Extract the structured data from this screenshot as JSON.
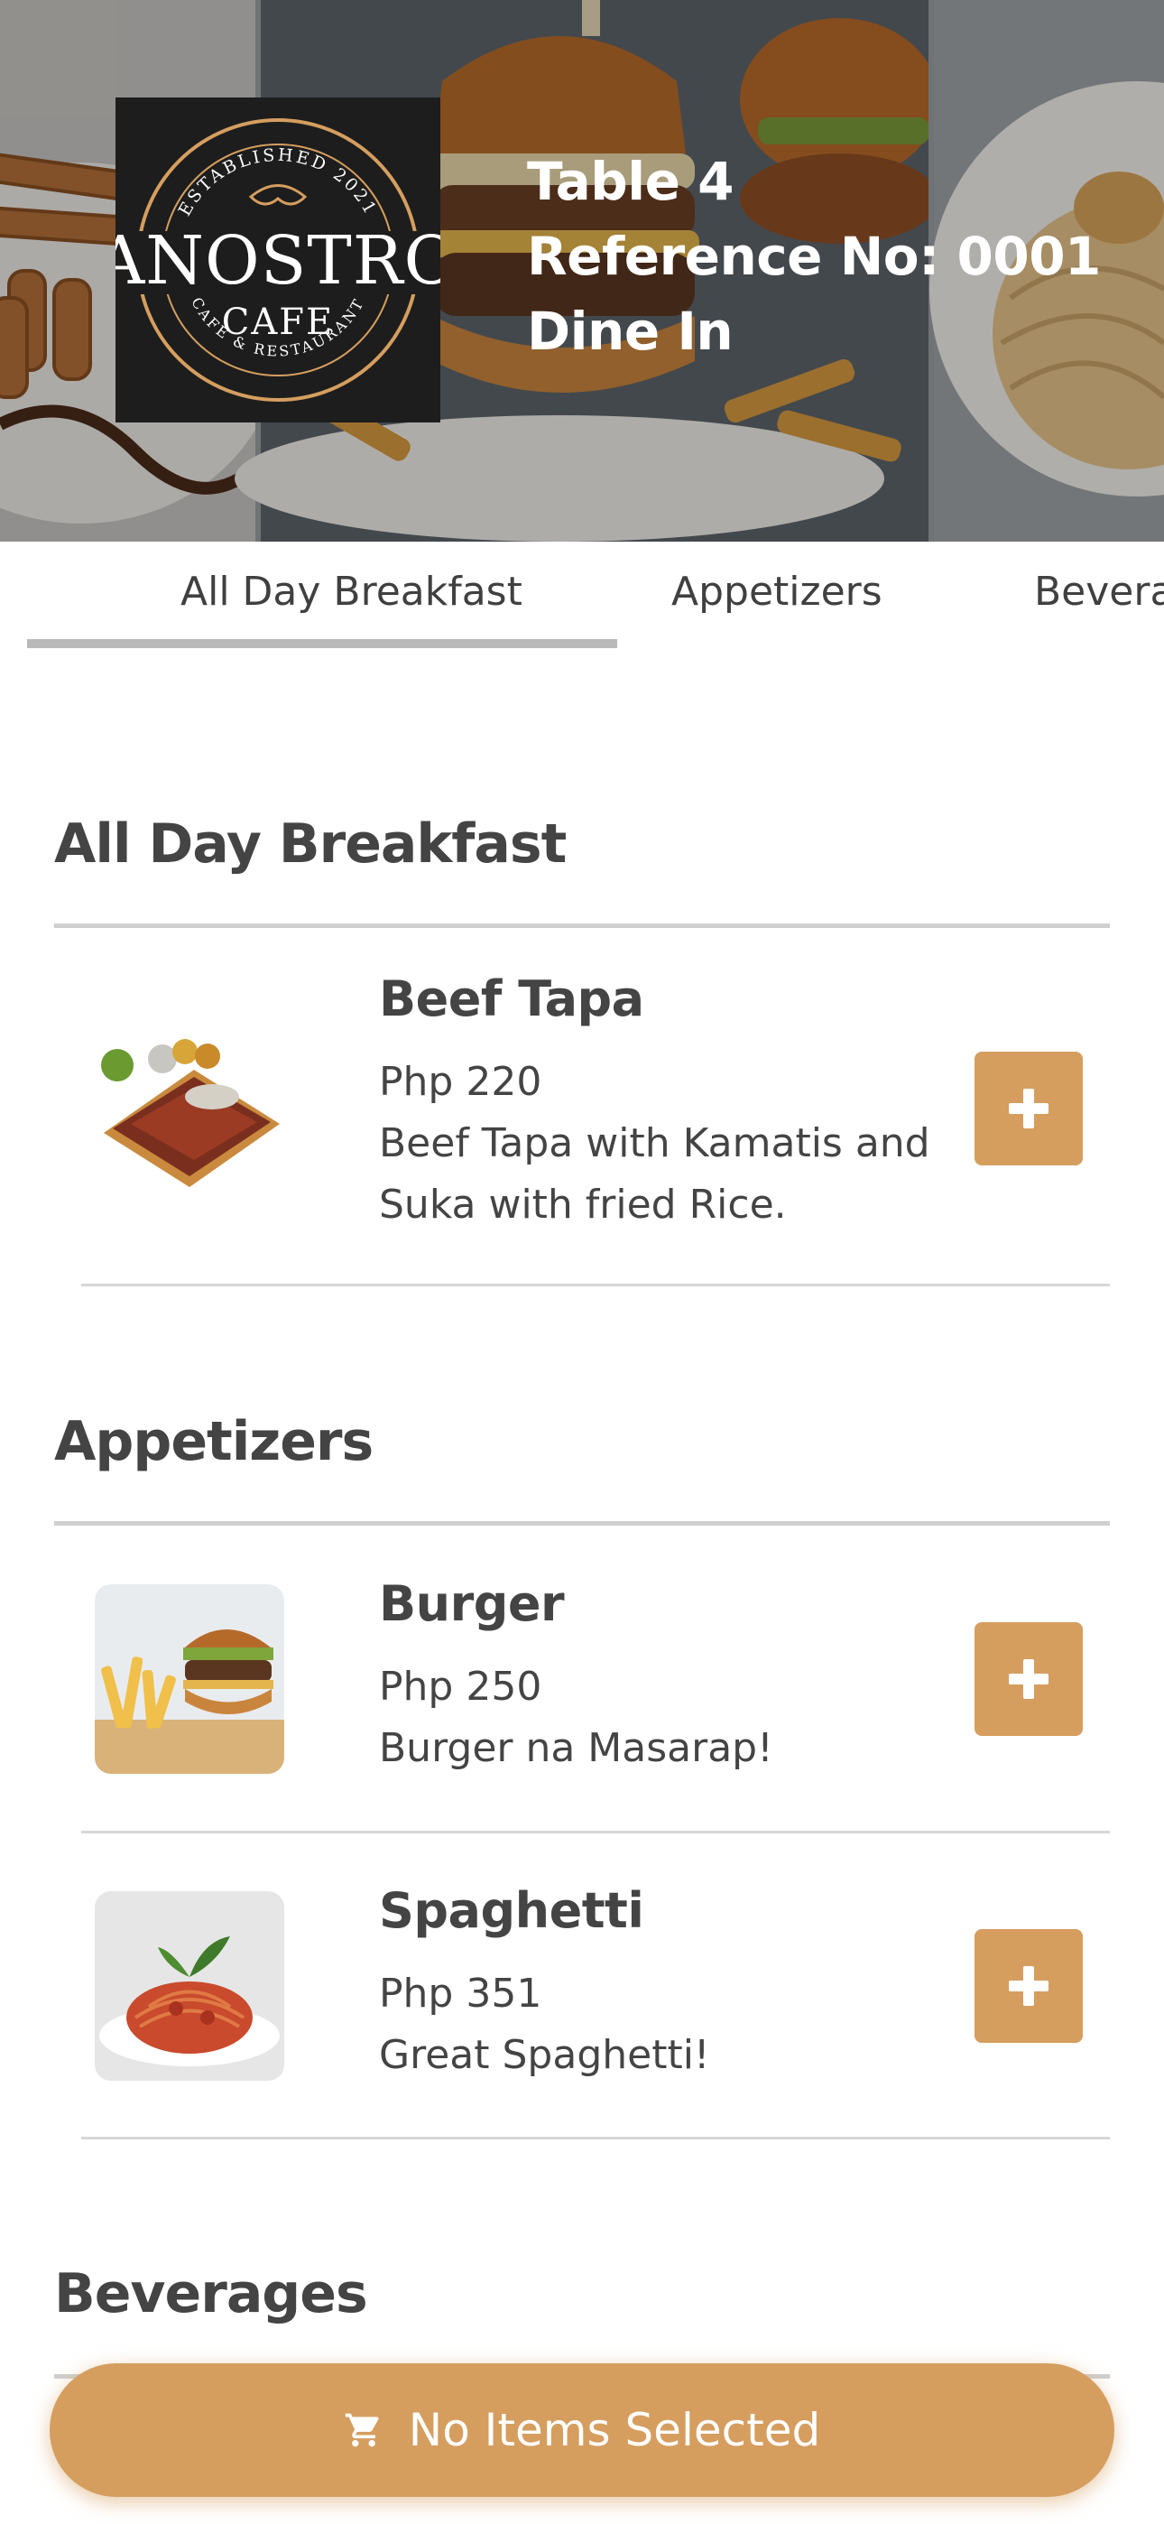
{
  "header": {
    "table": "Table 4",
    "reference": "Reference No: 0001",
    "dine_mode": "Dine In",
    "logo": {
      "top_arc": "ESTABLISHED 2021",
      "name": "ANOSTRO",
      "sub": "CAFE",
      "bottom_arc": "CAFE & RESTAURANT"
    }
  },
  "tabs": [
    {
      "label": "All Day Breakfast",
      "active": true
    },
    {
      "label": "Appetizers",
      "active": false
    },
    {
      "label": "Beverages",
      "active": false
    }
  ],
  "sections": [
    {
      "title": "All Day Breakfast",
      "items": [
        {
          "name": "Beef Tapa",
          "price": "Php 220",
          "description": "Beef Tapa with Kamatis and Suka with fried Rice."
        }
      ]
    },
    {
      "title": "Appetizers",
      "items": [
        {
          "name": "Burger",
          "price": "Php 250",
          "description": "Burger na Masarap!"
        },
        {
          "name": "Spaghetti",
          "price": "Php 351",
          "description": "Great Spaghetti!"
        }
      ]
    },
    {
      "title": "Beverages",
      "items": []
    }
  ],
  "cart": {
    "label": "No Items Selected",
    "icon": "cart-icon"
  },
  "colors": {
    "accent": "#d59e5f",
    "text": "#444444",
    "rule": "#cfcfcf"
  }
}
